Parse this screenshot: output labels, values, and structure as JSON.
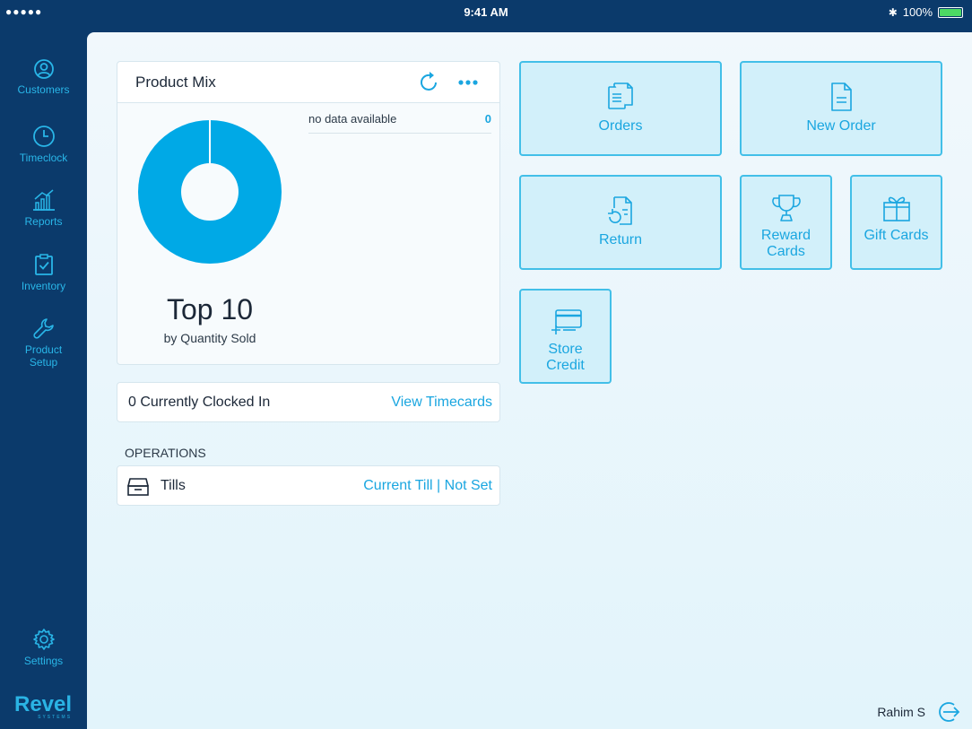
{
  "status_bar": {
    "signal": "●●●●● ",
    "time": "9:41 AM",
    "battery_label": "100%",
    "battery_level": 1.0
  },
  "sidebar": {
    "items": [
      {
        "label": "Customers",
        "icon": "customers-icon"
      },
      {
        "label": "Timeclock",
        "icon": "clock-icon"
      },
      {
        "label": "Reports",
        "icon": "reports-icon"
      },
      {
        "label": "Inventory",
        "icon": "inventory-icon"
      },
      {
        "label_line1": "Product",
        "label_line2": "Setup",
        "icon": "wrench-icon"
      }
    ],
    "settings": {
      "label": "Settings",
      "icon": "gear-icon"
    },
    "logo": "Revel",
    "logo_sub": "SYSTEMS"
  },
  "product_mix": {
    "title": "Product Mix",
    "no_data_label": "no data available",
    "no_data_value": "0",
    "headline": "Top 10",
    "subheadline": "by Quantity Sold"
  },
  "clocked_in": {
    "text": "0 Currently Clocked In",
    "link": "View Timecards"
  },
  "operations": {
    "section_label": "OPERATIONS",
    "tills_label": "Tills",
    "till_status": "Current Till | Not Set"
  },
  "tiles": {
    "orders": "Orders",
    "new_order": "New Order",
    "return": "Return",
    "reward_line1": "Reward",
    "reward_line2": "Cards",
    "gift_cards": "Gift Cards",
    "store_line1": "Store",
    "store_line2": "Credit"
  },
  "footer": {
    "user_name": "Rahim S"
  },
  "colors": {
    "accent": "#1aa6e0",
    "sidebar_bg": "#0b3a6b",
    "tile_bg": "#d2f0fa",
    "tile_border": "#42bfe8",
    "donut": "#00a9e6"
  }
}
